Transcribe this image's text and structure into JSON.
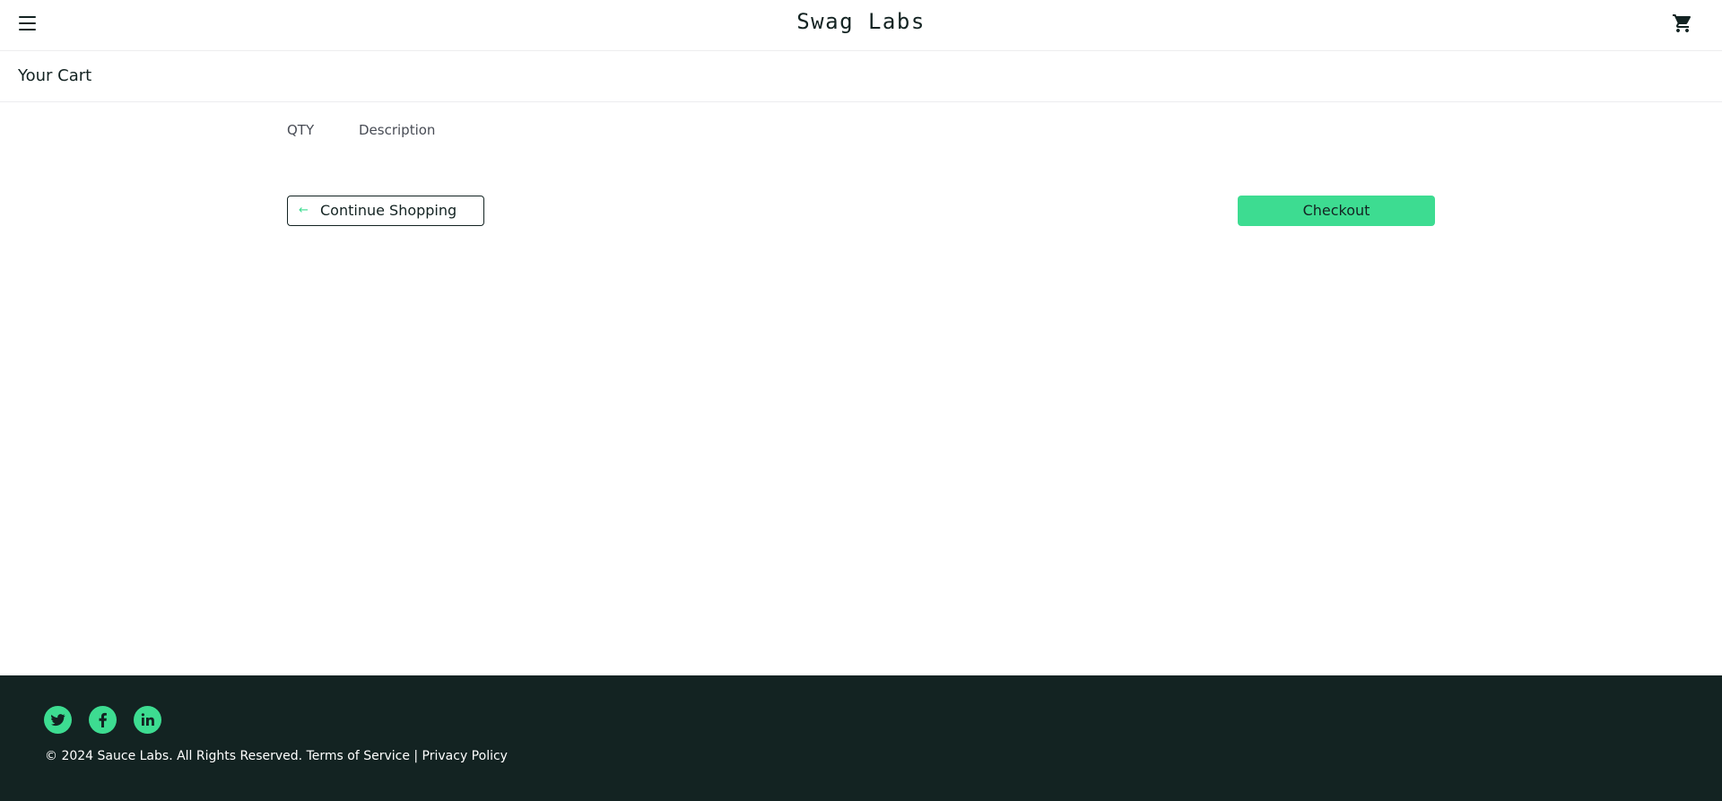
{
  "header": {
    "app_title": "Swag Labs",
    "menu_icon": "hamburger-menu-icon",
    "cart_icon": "shopping-cart-icon"
  },
  "secondary_header": {
    "title": "Your Cart"
  },
  "cart": {
    "qty_label": "QTY",
    "description_label": "Description",
    "items": [],
    "continue_label": "Continue Shopping",
    "continue_icon": "arrow-left-icon",
    "checkout_label": "Checkout"
  },
  "footer": {
    "social": [
      {
        "name": "twitter-icon"
      },
      {
        "name": "facebook-icon"
      },
      {
        "name": "linkedin-icon"
      }
    ],
    "copy_text": "© 2024 Sauce Labs. All Rights Reserved. Terms of Service | Privacy Policy"
  },
  "colors": {
    "accent": "#3ddc91",
    "dark": "#132322",
    "border": "#ededef"
  }
}
